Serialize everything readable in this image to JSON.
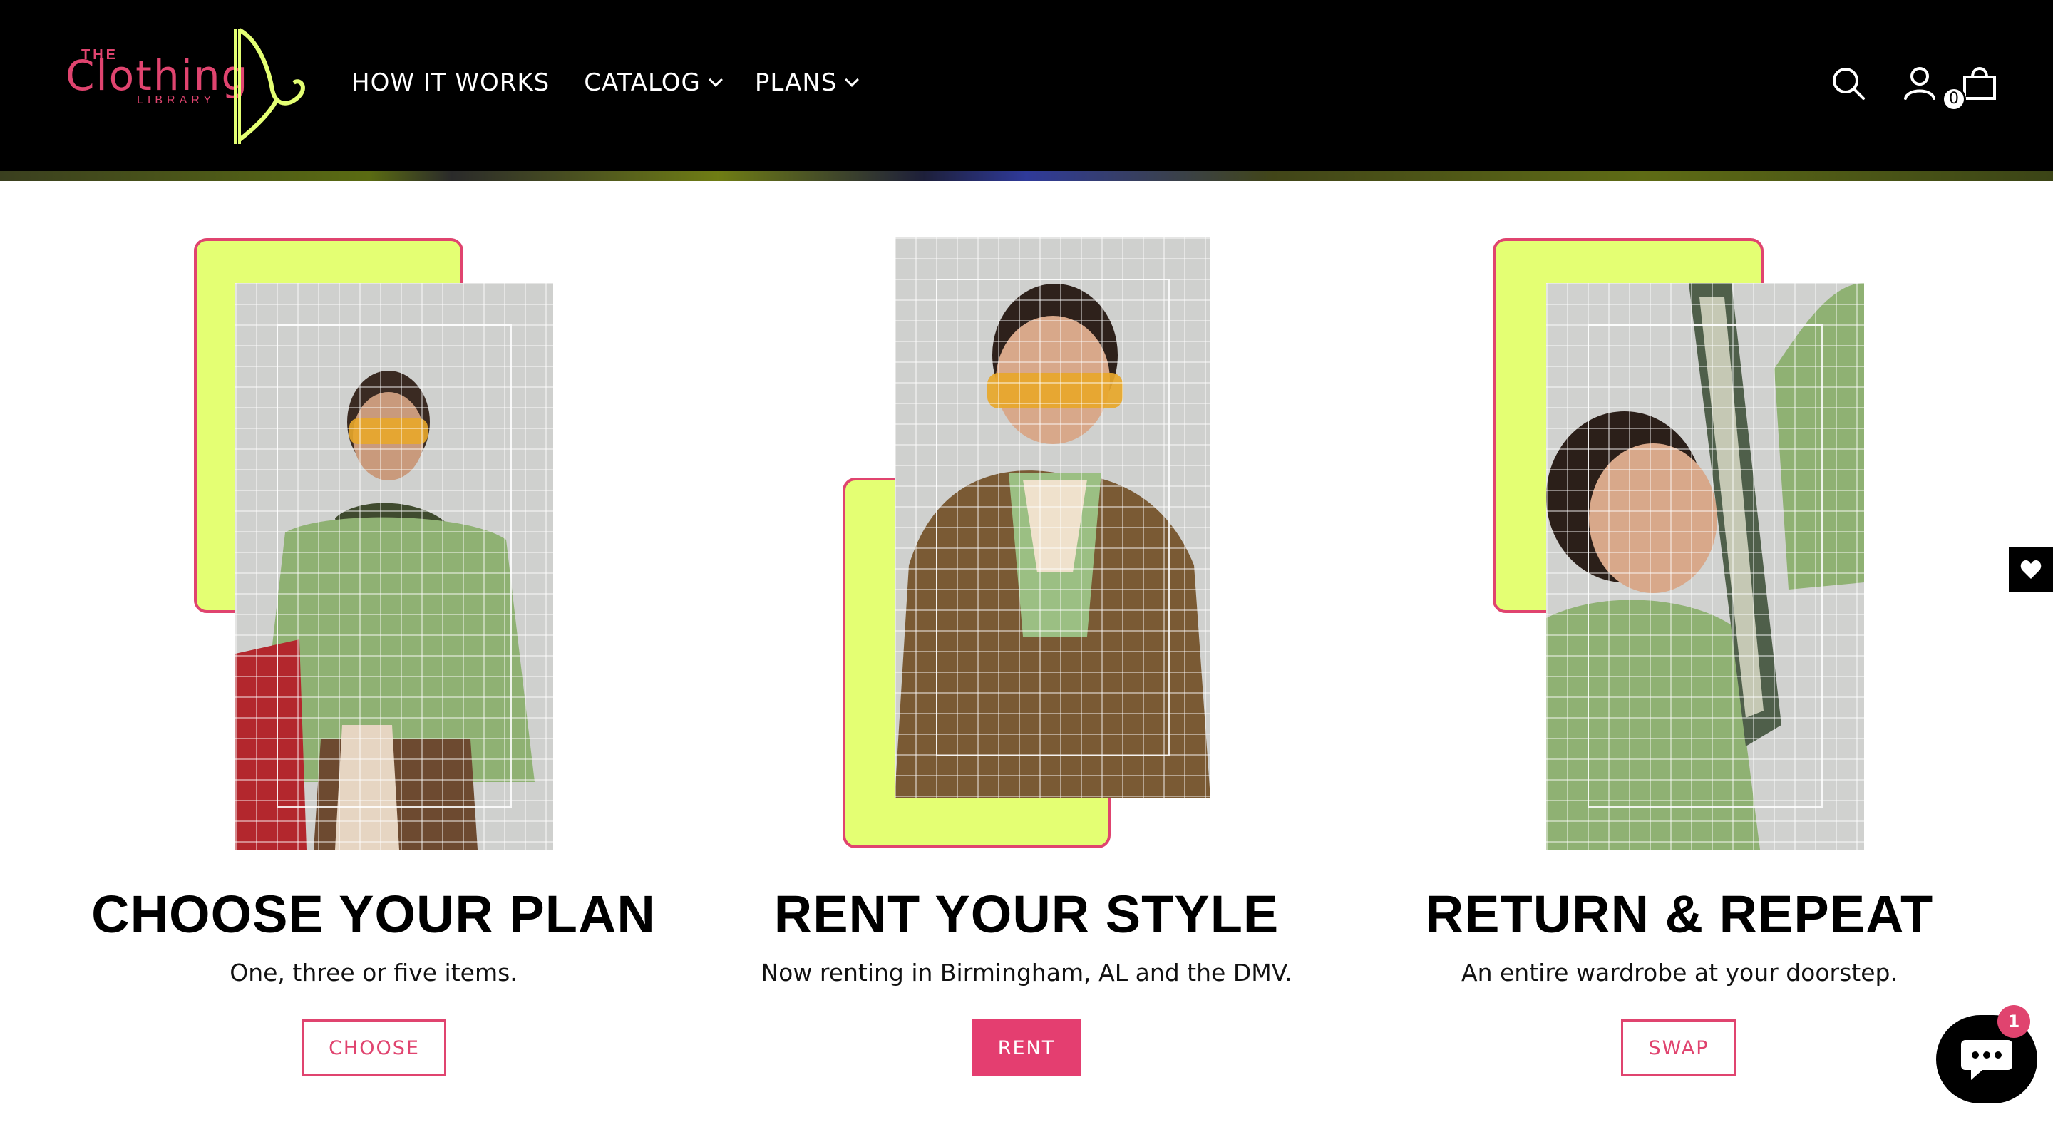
{
  "brand": {
    "logo_the": "THE",
    "logo_name": "Clothing",
    "logo_sub": "LIBRARY",
    "primary_color": "#e0446f",
    "accent_color": "#e4ff73"
  },
  "nav": {
    "items": [
      {
        "label": "HOW IT WORKS",
        "has_dropdown": false
      },
      {
        "label": "CATALOG",
        "has_dropdown": true
      },
      {
        "label": "PLANS",
        "has_dropdown": true
      }
    ]
  },
  "header_icons": {
    "search": "search-icon",
    "account": "account-icon",
    "cart": "cart-icon",
    "cart_count": "0"
  },
  "steps": [
    {
      "title": "CHOOSE YOUR PLAN",
      "subtitle": "One, three or five items.",
      "button": "CHOOSE",
      "photo": "woman in green shirt, yellow sunglasses, scarf"
    },
    {
      "title": "RENT YOUR STYLE",
      "subtitle": "Now renting in Birmingham, AL and the DMV.",
      "button": "RENT",
      "photo": "woman in plaid blazer, yellow sunglasses"
    },
    {
      "title": "RETURN & REPEAT",
      "subtitle": "An entire wardrobe at your doorstep.",
      "button": "SWAP",
      "photo": "woman holding patterned scarf"
    }
  ],
  "widgets": {
    "wishlist": "heart-icon",
    "chat": "chat-icon",
    "chat_badge": "1"
  }
}
